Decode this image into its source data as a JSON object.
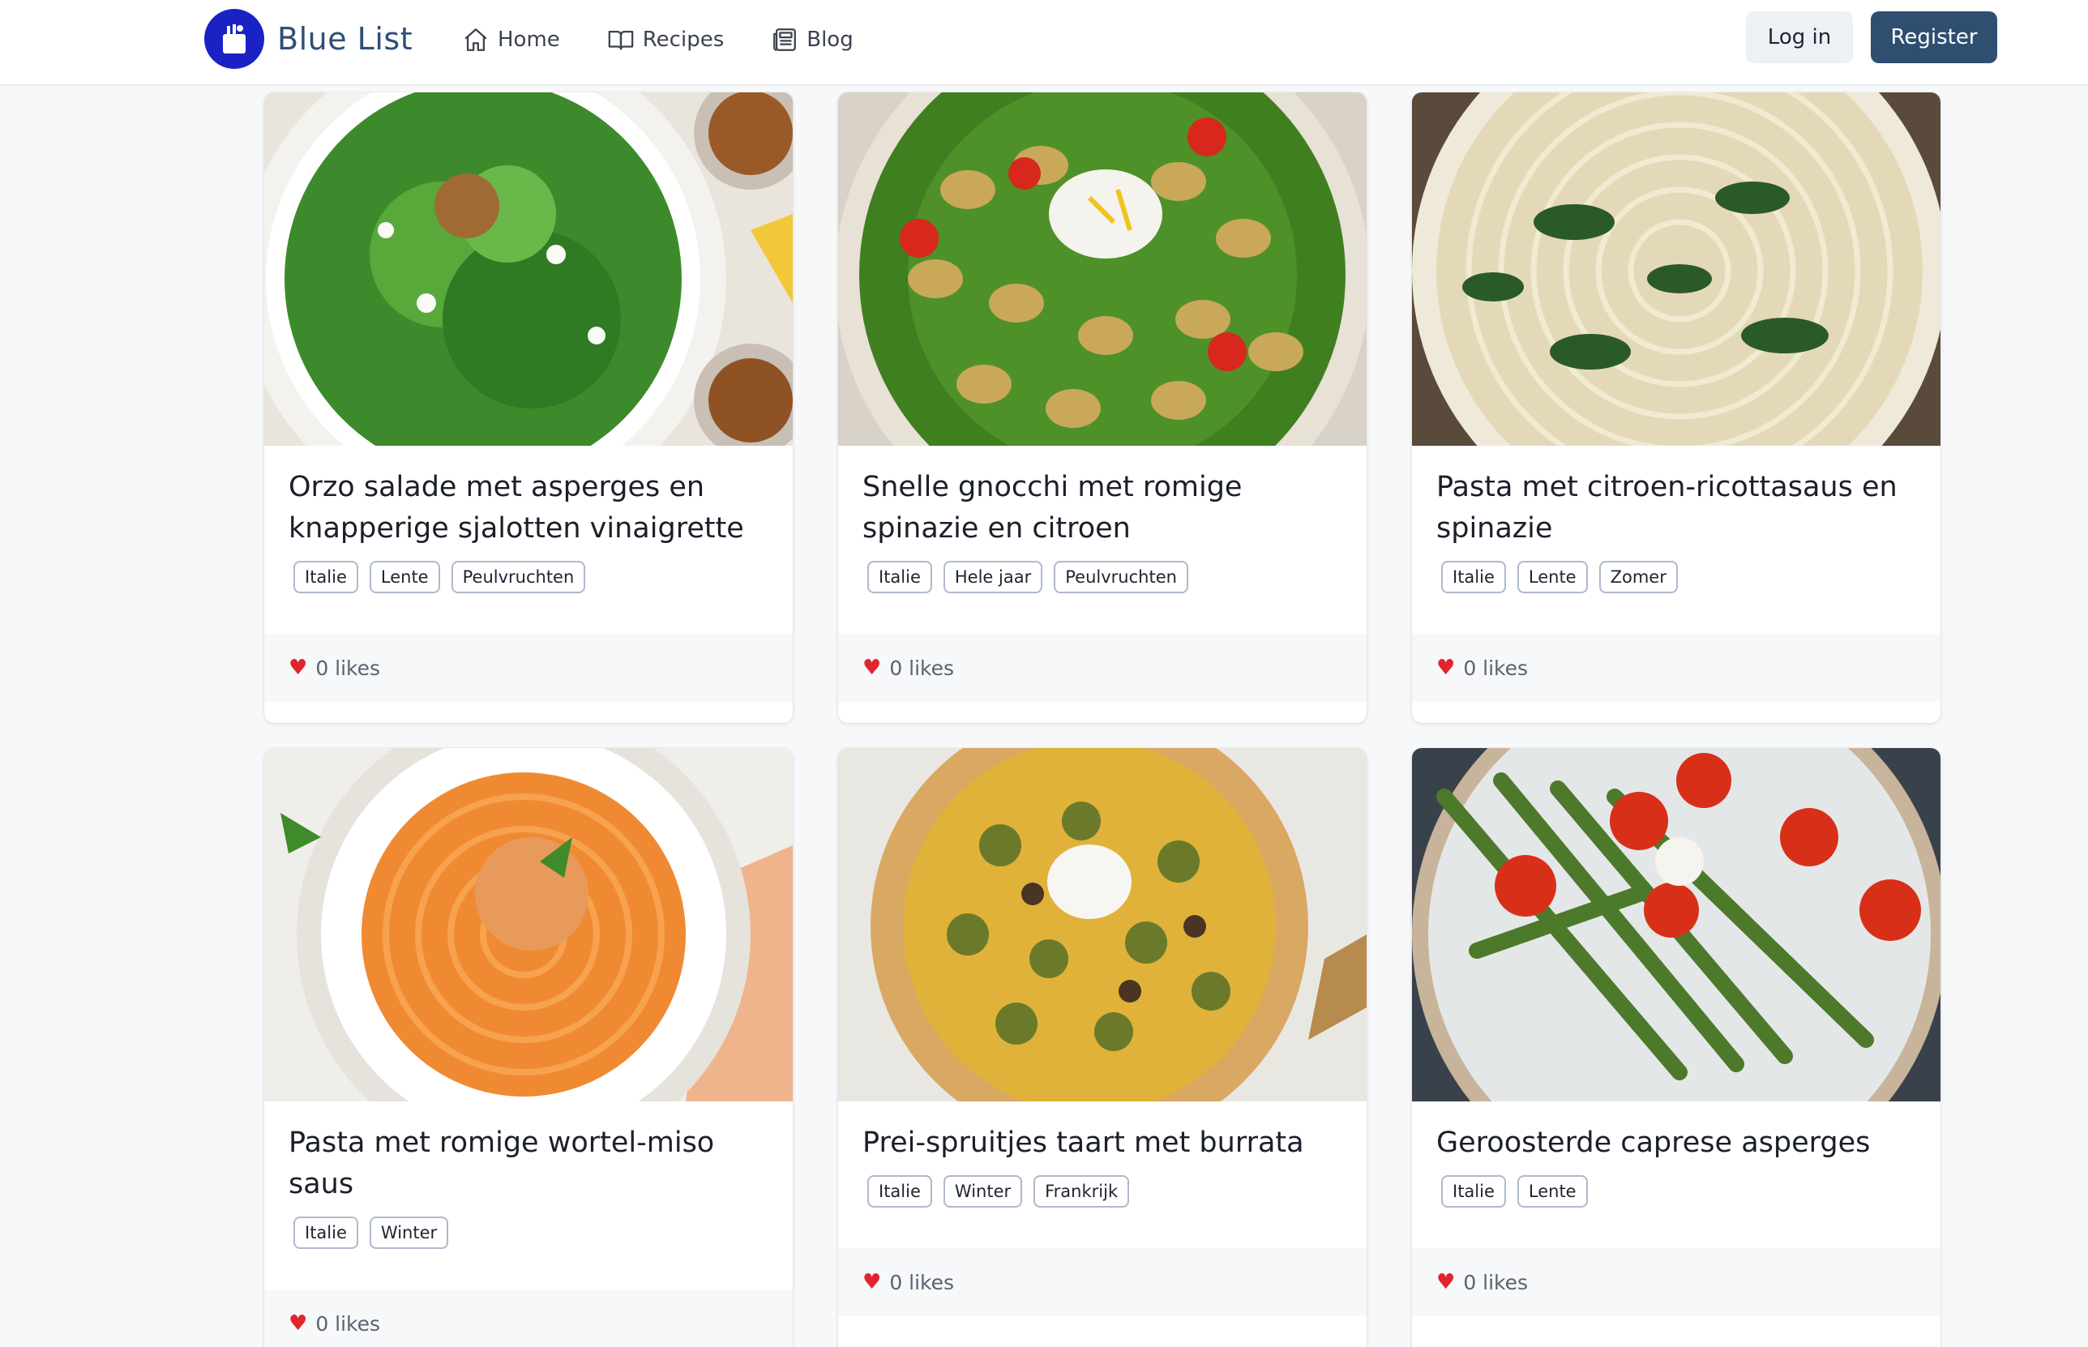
{
  "header": {
    "brand": "Blue List",
    "nav": [
      {
        "label": "Home",
        "icon": "home-icon"
      },
      {
        "label": "Recipes",
        "icon": "book-icon"
      },
      {
        "label": "Blog",
        "icon": "newspaper-icon"
      }
    ],
    "login_label": "Log in",
    "register_label": "Register"
  },
  "colors": {
    "brand_logo_bg": "#1b22c4",
    "register_bg": "#2f4e70",
    "login_bg": "#edf1f5",
    "heart": "#e0262c"
  },
  "recipes": [
    {
      "title": "Orzo salade met asperges en knapperige sjalotten vinaigrette",
      "tags": [
        "Italie",
        "Lente",
        "Peulvruchten"
      ],
      "likes": "0 likes",
      "image": "orzo-salad-photo"
    },
    {
      "title": "Snelle gnocchi met romige spinazie en citroen",
      "tags": [
        "Italie",
        "Hele jaar",
        "Peulvruchten"
      ],
      "likes": "0 likes",
      "image": "gnocchi-photo"
    },
    {
      "title": "Pasta met citroen-ricottasaus en spinazie",
      "tags": [
        "Italie",
        "Lente",
        "Zomer"
      ],
      "likes": "0 likes",
      "image": "spinach-pasta-photo"
    },
    {
      "title": "Pasta met romige wortel-miso saus",
      "tags": [
        "Italie",
        "Winter"
      ],
      "likes": "0 likes",
      "image": "carrot-miso-pasta-photo"
    },
    {
      "title": "Prei-spruitjes taart met burrata",
      "tags": [
        "Italie",
        "Winter",
        "Frankrijk"
      ],
      "likes": "0 likes",
      "image": "sprouts-tart-photo"
    },
    {
      "title": "Geroosterde caprese asperges",
      "tags": [
        "Italie",
        "Lente"
      ],
      "likes": "0 likes",
      "image": "asparagus-caprese-photo"
    }
  ]
}
